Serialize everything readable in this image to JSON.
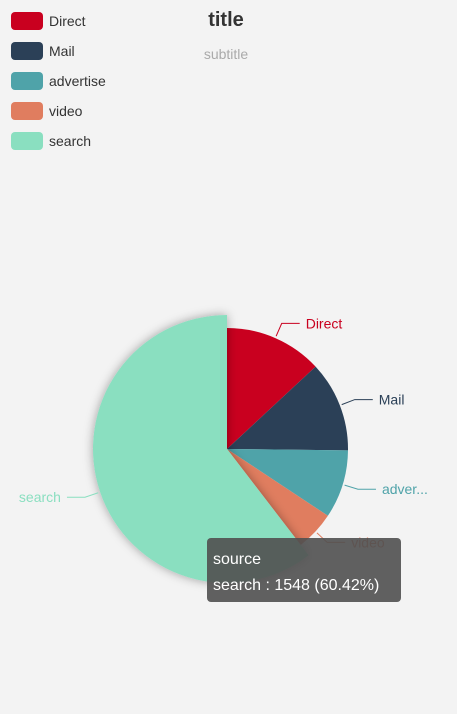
{
  "chart_data": {
    "type": "pie",
    "title": "title",
    "subtitle": "subtitle",
    "legend_position": "top-left",
    "series_name": "source",
    "slices": [
      {
        "name": "Direct",
        "value": 335,
        "color": "#c9001f"
      },
      {
        "name": "Mail",
        "value": 310,
        "color": "#2b4057"
      },
      {
        "name": "advertise",
        "value": 234,
        "color": "#4fa3a9"
      },
      {
        "name": "video",
        "value": 135,
        "color": "#e07d5f"
      },
      {
        "name": "search",
        "value": 1548,
        "color": "#8adfc0"
      }
    ],
    "slice_labels": [
      "Direct",
      "Mail",
      "adver...",
      "video",
      "search"
    ],
    "highlighted": "search"
  },
  "tooltip": {
    "header": "source",
    "line": "search : 1548 (60.42%)"
  }
}
